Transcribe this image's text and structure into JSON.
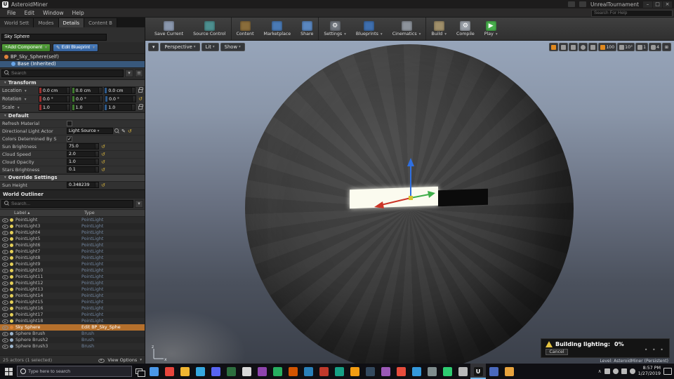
{
  "titlebar": {
    "app_title": "AsteroidMiner",
    "project_title": "UnrealTournament",
    "menus": [
      "File",
      "Edit",
      "Window",
      "Help"
    ],
    "window_controls": {
      "minimize": "–",
      "maximize": "□",
      "close": "×"
    },
    "help_search_placeholder": "Search For Help"
  },
  "panel_tabs": [
    {
      "label": "World Sett",
      "active": false
    },
    {
      "label": "Modes",
      "active": false
    },
    {
      "label": "Details",
      "active": true
    },
    {
      "label": "Content B",
      "active": false
    }
  ],
  "toolbar": {
    "buttons": [
      {
        "label": "Save Current",
        "icon": "save-icon",
        "color": "#8a97ad"
      },
      {
        "label": "Source Control",
        "icon": "source-control-icon",
        "color": "#4d8f8f"
      },
      {
        "label": "Content",
        "icon": "content-icon",
        "color": "#8a6d3b",
        "sep": true
      },
      {
        "label": "Marketplace",
        "icon": "marketplace-icon",
        "color": "#4a7ab5"
      },
      {
        "label": "Share",
        "icon": "share-icon",
        "color": "#5a87c0"
      },
      {
        "label": "Settings",
        "icon": "settings-icon",
        "color": "#70767e",
        "glyph": "⚙",
        "caret": true,
        "sep": true
      },
      {
        "label": "Blueprints",
        "icon": "blueprints-icon",
        "color": "#3f6fae",
        "caret": true
      },
      {
        "label": "Cinematics",
        "icon": "cinematics-icon",
        "color": "#8d939b",
        "caret": true
      },
      {
        "label": "Build",
        "icon": "build-icon",
        "color": "#a08f6a",
        "caret": true,
        "sep": true
      },
      {
        "label": "Compile",
        "icon": "compile-icon",
        "color": "#9aa0a8",
        "glyph": "⚙"
      },
      {
        "label": "Play",
        "icon": "play-icon",
        "color": "#49b04d",
        "glyph": "▶",
        "caret": true
      }
    ]
  },
  "details": {
    "name_filter": "Sky Sphere",
    "add_component_label": "+Add Component",
    "edit_blueprint_label": "Edit Blueprint",
    "component_root": "BP_Sky_Sphere(self)",
    "component_child": "Base (Inherited)",
    "search_placeholder": "Search",
    "transform": {
      "header": "Transform",
      "rows": [
        {
          "label": "Location",
          "x": "0.0 cm",
          "y": "0.0 cm",
          "z": "0.0 cm",
          "lock": true
        },
        {
          "label": "Rotation",
          "x": "0.0 °",
          "y": "0.0 °",
          "z": "0.0 °",
          "reset": true
        },
        {
          "label": "Scale",
          "x": "1.0",
          "y": "1.0",
          "z": "1.0",
          "lock": true
        }
      ]
    },
    "default_section": {
      "header": "Default",
      "refresh_material_label": "Refresh Material",
      "directional_light_label": "Directional Light Actor",
      "directional_light_value": "Light Source",
      "colors_determined_label": "Colors Determined By S",
      "sun_brightness_label": "Sun Brightness",
      "sun_brightness_value": "75.0",
      "cloud_speed_label": "Cloud Speed",
      "cloud_speed_value": "2.0",
      "cloud_opacity_label": "Cloud Opacity",
      "cloud_opacity_value": "1.0",
      "stars_brightness_label": "Stars Brightness",
      "stars_brightness_value": "0.1"
    },
    "override_section": {
      "header": "Override Settings",
      "sun_height_label": "Sun Height",
      "sun_height_value": "0.348239"
    }
  },
  "outliner": {
    "title": "World Outliner",
    "search_placeholder": "Search...",
    "columns": {
      "label": "Label",
      "type": "Type"
    },
    "rows": [
      {
        "label": "PointLight",
        "type": "PointLight",
        "icon_color": "#e5d058"
      },
      {
        "label": "PointLight3",
        "type": "PointLight",
        "icon_color": "#e5d058"
      },
      {
        "label": "PointLight4",
        "type": "PointLight",
        "icon_color": "#e5d058"
      },
      {
        "label": "PointLight5",
        "type": "PointLight",
        "icon_color": "#e5d058"
      },
      {
        "label": "PointLight6",
        "type": "PointLight",
        "icon_color": "#e5d058"
      },
      {
        "label": "PointLight7",
        "type": "PointLight",
        "icon_color": "#e5d058"
      },
      {
        "label": "PointLight8",
        "type": "PointLight",
        "icon_color": "#e5d058"
      },
      {
        "label": "PointLight9",
        "type": "PointLight",
        "icon_color": "#e5d058"
      },
      {
        "label": "PointLight10",
        "type": "PointLight",
        "icon_color": "#e5d058"
      },
      {
        "label": "PointLight11",
        "type": "PointLight",
        "icon_color": "#e5d058"
      },
      {
        "label": "PointLight12",
        "type": "PointLight",
        "icon_color": "#e5d058"
      },
      {
        "label": "PointLight13",
        "type": "PointLight",
        "icon_color": "#e5d058"
      },
      {
        "label": "PointLight14",
        "type": "PointLight",
        "icon_color": "#e5d058"
      },
      {
        "label": "PointLight15",
        "type": "PointLight",
        "icon_color": "#e5d058"
      },
      {
        "label": "PointLight16",
        "type": "PointLight",
        "icon_color": "#e5d058"
      },
      {
        "label": "PointLight17",
        "type": "PointLight",
        "icon_color": "#e5d058"
      },
      {
        "label": "PointLight18",
        "type": "PointLight",
        "icon_color": "#e5d058"
      },
      {
        "label": "Sky Sphere",
        "type": "Edit BP_Sky_Sphe",
        "icon_color": "#e08535",
        "selected": true
      },
      {
        "label": "Sphere Brush",
        "type": "Brush",
        "icon_color": "#9db6ce"
      },
      {
        "label": "Sphere Brush2",
        "type": "Brush",
        "icon_color": "#9db6ce"
      },
      {
        "label": "Sphere Brush3",
        "type": "Brush",
        "icon_color": "#9db6ce"
      }
    ],
    "footer_left": "25 actors (1 selected)",
    "view_options_label": "View Options"
  },
  "viewport": {
    "perspective_label": "Perspective",
    "lit_label": "Lit",
    "show_label": "Show",
    "grid_snap_value": "100",
    "rotation_snap_value": "10°",
    "scale_snap_value": "1",
    "camera_speed_value": "4",
    "level_status": "Level: AsteroidMiner (Persistent)"
  },
  "notification": {
    "message": "Building lighting:",
    "progress": "0%",
    "cancel_label": "Cancel",
    "dots": "• • •"
  },
  "taskbar": {
    "search_placeholder": "Type here to search",
    "time": "8:57 PM",
    "date": "1/27/2019",
    "apps": [
      {
        "color": "#4a97e8"
      },
      {
        "color": "#e8453c"
      },
      {
        "color": "#f2b632"
      },
      {
        "color": "#35a8e0"
      },
      {
        "color": "#5865f2"
      },
      {
        "color": "#2d6e3e"
      },
      {
        "color": "#d8d8d8"
      },
      {
        "color": "#8e44ad"
      },
      {
        "color": "#27ae60"
      },
      {
        "color": "#d35400"
      },
      {
        "color": "#2980b9"
      },
      {
        "color": "#c0392b"
      },
      {
        "color": "#16a085"
      },
      {
        "color": "#f39c12"
      },
      {
        "color": "#34495e"
      },
      {
        "color": "#9b59b6"
      },
      {
        "color": "#e74c3c"
      },
      {
        "color": "#3498db"
      },
      {
        "color": "#7f8c8d"
      },
      {
        "color": "#2ecc71"
      },
      {
        "color": "#b8b8b8"
      },
      {
        "color": "#151515",
        "glyph": "U",
        "active": true
      },
      {
        "color": "#4a69bd"
      },
      {
        "color": "#e8a33d"
      }
    ]
  }
}
